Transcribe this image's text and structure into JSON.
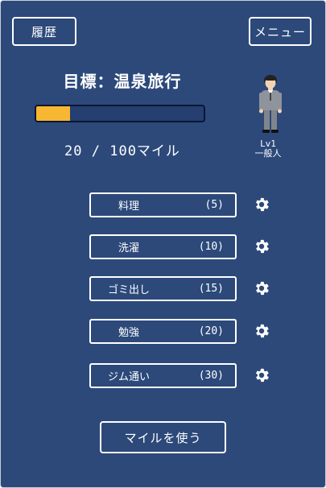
{
  "header": {
    "history_label": "履歴",
    "menu_label": "メニュー"
  },
  "goal": {
    "title": "目標：温泉旅行",
    "current_miles": 20,
    "target_miles": 100,
    "miles_text": "20 / 100マイル",
    "progress_fraction": 0.2
  },
  "user": {
    "level": "Lv1",
    "rank": "一般人"
  },
  "tasks": [
    {
      "name": "料理",
      "miles": "(5)"
    },
    {
      "name": "洗濯",
      "miles": "(10)"
    },
    {
      "name": "ゴミ出し",
      "miles": "(15)"
    },
    {
      "name": "勉強",
      "miles": "(20)"
    },
    {
      "name": "ジム通い",
      "miles": "(30)"
    }
  ],
  "actions": {
    "use_miles_label": "マイルを使う"
  },
  "colors": {
    "background": "#2c497a",
    "progress_fill": "#f7b733",
    "foreground": "#ffffff"
  },
  "icons": {
    "task_settings": "gear-icon"
  }
}
